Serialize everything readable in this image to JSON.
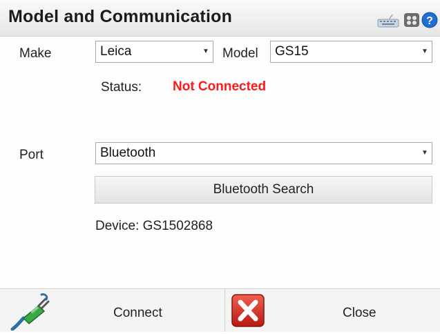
{
  "window": {
    "title": "Model and Communication"
  },
  "toolbar_icons": [
    {
      "name": "keyboard-icon"
    },
    {
      "name": "calculator-icon"
    },
    {
      "name": "help-icon"
    }
  ],
  "form": {
    "make_label": "Make",
    "make_value": "Leica",
    "model_label": "Model",
    "model_value": "GS15",
    "status_label": "Status:",
    "status_value": "Not Connected",
    "status_color": "#ff1a1a",
    "port_label": "Port",
    "port_value": "Bluetooth",
    "search_button": "Bluetooth Search",
    "device_text": "Device: GS1502868"
  },
  "footer": {
    "connect_label": "Connect",
    "close_label": "Close"
  },
  "colors": {
    "close_icon_red": "#d8281e",
    "help_blue": "#1e6fd0"
  }
}
